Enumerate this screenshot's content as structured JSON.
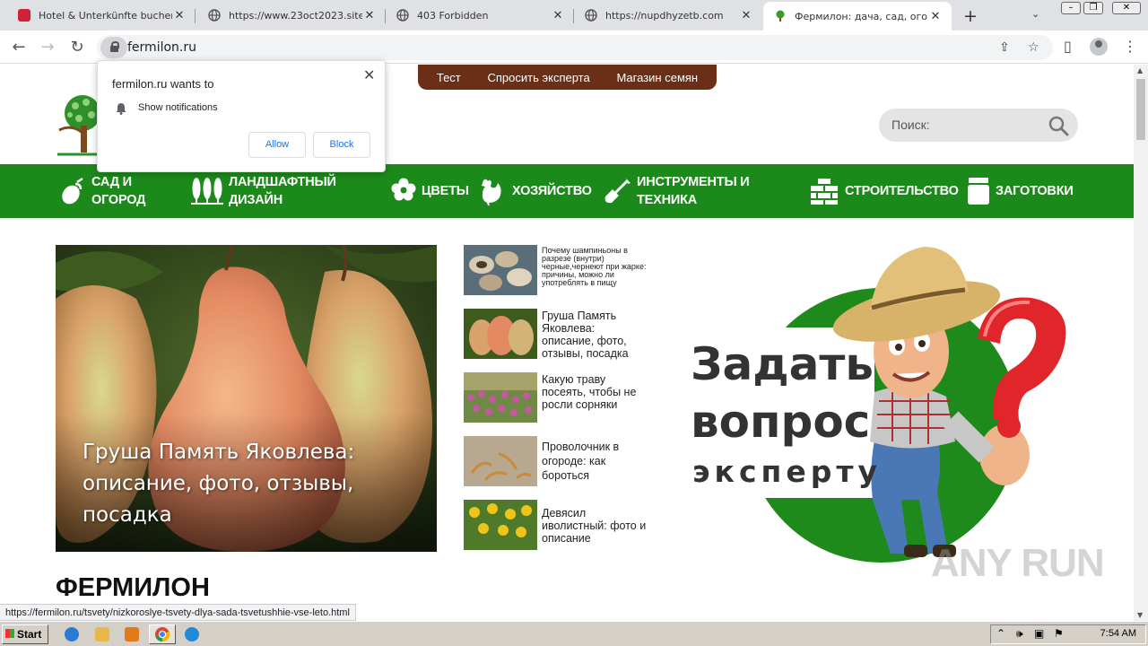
{
  "browser": {
    "tabs": [
      {
        "title": "Hotel & Unterkünfte buchen | A",
        "icon": "booking-favicon"
      },
      {
        "title": "https://www.23oct2023.site",
        "icon": "globe-icon"
      },
      {
        "title": "403 Forbidden",
        "icon": "globe-icon"
      },
      {
        "title": "https://nupdhyzetb.com",
        "icon": "globe-icon"
      },
      {
        "title": "Фермилон: дача, сад, огород",
        "icon": "tree-favicon",
        "active": true
      }
    ],
    "new_tab": "+",
    "url": "fermilon.ru",
    "status_url": "https://fermilon.ru/tsvety/nizkoroslye-tsvety-dlya-sada-tsvetushhie-vse-leto.html"
  },
  "notification": {
    "title": "fermilon.ru wants to",
    "permission": "Show notifications",
    "allow": "Allow",
    "block": "Block"
  },
  "site": {
    "top_links": [
      "Тест",
      "Спросить эксперта",
      "Магазин семян"
    ],
    "search_placeholder": "Поиск:",
    "nav": [
      {
        "line1": "САД И",
        "line2": "ОГОРОД",
        "icon": "eggplant-icon"
      },
      {
        "line1": "ЛАНДШАФТНЫЙ",
        "line2": "ДИЗАЙН",
        "icon": "trees-icon"
      },
      {
        "line1": "ЦВЕТЫ",
        "line2": "",
        "icon": "flower-icon"
      },
      {
        "line1": "ХОЗЯЙСТВО",
        "line2": "",
        "icon": "rooster-icon"
      },
      {
        "line1": "ИНСТРУМЕНТЫ И",
        "line2": "ТЕХНИКА",
        "icon": "shovel-icon"
      },
      {
        "line1": "СТРОИТЕЛЬСТВО",
        "line2": "",
        "icon": "bricks-icon"
      },
      {
        "line1": "ЗАГОТОВКИ",
        "line2": "",
        "icon": "jar-icon"
      }
    ],
    "hero_title": "Груша Память Яковлева: описание, фото, отзывы, посадка",
    "articles": [
      "Почему шампиньоны в разрезе (внутри) черные,чернеют при жарке: причины, можно ли употреблять в пищу",
      "Груша Память Яковлева: описание, фото, отзывы, посадка",
      "Какую траву посеять, чтобы не росли сорняки",
      "Проволочник в огороде: как бороться",
      "Девясил иволистный: фото и описание"
    ],
    "banner": {
      "line1": "Задать",
      "line2": "вопрос",
      "line3": "эксперту"
    },
    "section_title": "ФЕРМИЛОН"
  },
  "watermark": "ANY RUN",
  "taskbar": {
    "start": "Start",
    "time": "7:54 AM"
  },
  "colors": {
    "nav_green": "#1c8a1a",
    "top_brown": "#6b2e16",
    "banner_green": "#1e8a1c"
  }
}
